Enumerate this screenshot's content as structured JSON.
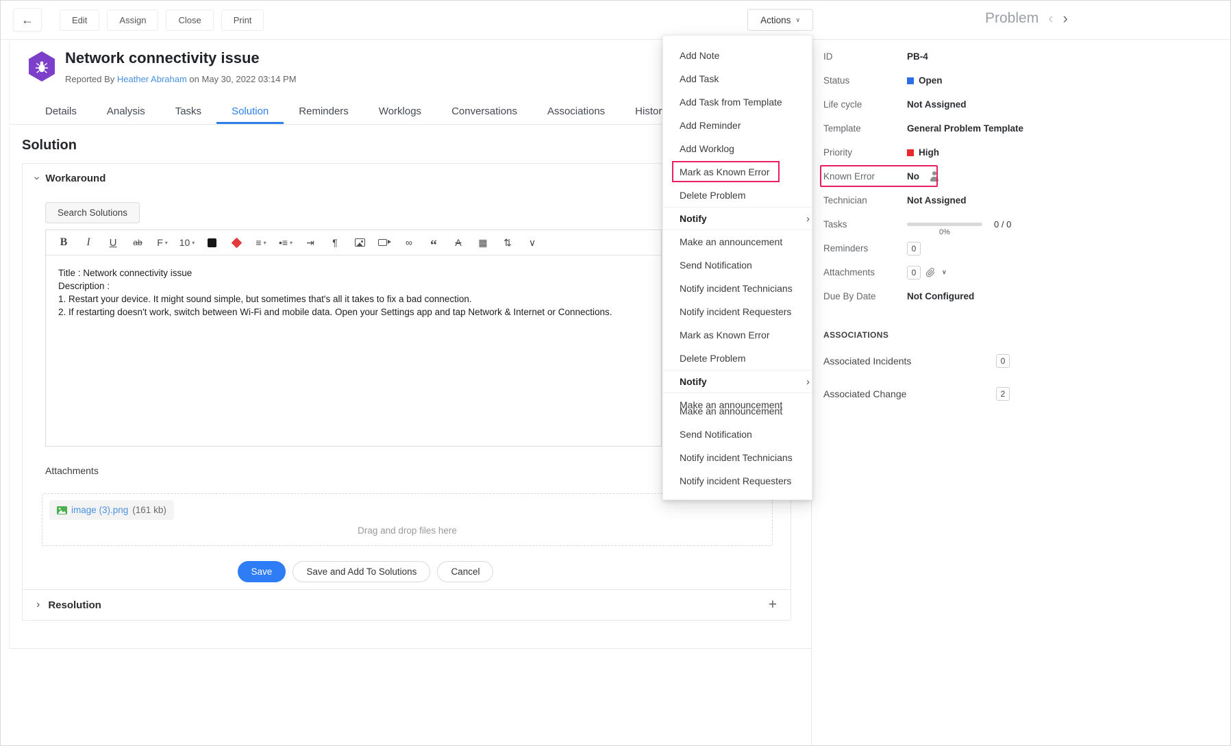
{
  "glyphs": {
    "back": "←",
    "chevron_down": "∨",
    "nav_prev": "‹",
    "nav_next": "›",
    "submenu": "›",
    "expand": "›",
    "plus": "+",
    "dropdown_small": "▾"
  },
  "topbar": {
    "buttons": {
      "edit": "Edit",
      "assign": "Assign",
      "close": "Close",
      "print": "Print"
    },
    "actions_label": "Actions",
    "context_title": "Problem"
  },
  "ticket": {
    "title": "Network connectivity issue",
    "reported_by_label": "Reported By",
    "reporter": "Heather Abraham",
    "reported_on": "on May 30, 2022 03:14 PM"
  },
  "tabs": [
    {
      "label": "Details"
    },
    {
      "label": "Analysis"
    },
    {
      "label": "Tasks"
    },
    {
      "label": "Solution"
    },
    {
      "label": "Reminders"
    },
    {
      "label": "Worklogs"
    },
    {
      "label": "Conversations"
    },
    {
      "label": "Associations"
    },
    {
      "label": "History"
    }
  ],
  "solution": {
    "heading": "Solution",
    "workaround_label": "Workaround",
    "search_button": "Search Solutions",
    "editor": {
      "toolbar": [
        {
          "name": "bold-icon",
          "glyph": "B"
        },
        {
          "name": "italic-icon",
          "glyph": "I"
        },
        {
          "name": "underline-icon",
          "glyph": "U"
        },
        {
          "name": "strikethrough-icon",
          "glyph": "ab"
        },
        {
          "name": "font-family-icon",
          "glyph": "F"
        },
        {
          "name": "font-size-select",
          "glyph": "10"
        },
        {
          "name": "text-color-icon",
          "glyph": ""
        },
        {
          "name": "highlight-color-icon",
          "glyph": ""
        },
        {
          "name": "align-icon",
          "glyph": "≡"
        },
        {
          "name": "list-icon",
          "glyph": "•≡"
        },
        {
          "name": "indent-icon",
          "glyph": "⇥"
        },
        {
          "name": "paragraph-icon",
          "glyph": "¶"
        },
        {
          "name": "insert-image-icon",
          "glyph": ""
        },
        {
          "name": "insert-video-icon",
          "glyph": ""
        },
        {
          "name": "insert-link-icon",
          "glyph": "∞"
        },
        {
          "name": "blockquote-icon",
          "glyph": "“"
        },
        {
          "name": "clear-format-icon",
          "glyph": "A"
        },
        {
          "name": "insert-table-icon",
          "glyph": "▦"
        },
        {
          "name": "line-spacing-icon",
          "glyph": "⇅"
        },
        {
          "name": "more-tools-icon",
          "glyph": "∨"
        }
      ],
      "lines": [
        "Title : Network connectivity issue",
        "Description :",
        "1. Restart your device. It might sound simple, but sometimes that's all it takes to fix a bad connection.",
        "2. If restarting doesn't work, switch between Wi-Fi and mobile data. Open your Settings app and tap Network & Internet or Connections."
      ]
    },
    "attachments_label": "Attachments",
    "attachment": {
      "name": "image (3).png",
      "size": "(161 kb)"
    },
    "drop_text": "Drag and drop files here",
    "buttons": {
      "save": "Save",
      "save_add": "Save and Add To Solutions",
      "cancel": "Cancel"
    },
    "resolution_label": "Resolution"
  },
  "actions_menu": {
    "highlight_color": "#e91e63",
    "items": [
      {
        "label": "Add Note"
      },
      {
        "label": "Add Task"
      },
      {
        "label": "Add Task from Template"
      },
      {
        "label": "Add Reminder"
      },
      {
        "label": "Add Worklog"
      },
      {
        "label": "Mark as Known Error",
        "highlighted": true
      },
      {
        "label": "Delete Problem"
      },
      {
        "label": "Notify",
        "header": true
      },
      {
        "label": "Make an announcement"
      },
      {
        "label": "Send Notification"
      },
      {
        "label": "Notify incident Technicians"
      },
      {
        "label": "Notify incident Requesters"
      },
      {
        "label": "Mark as Known Error"
      },
      {
        "label": "Delete Problem"
      },
      {
        "label": "Notify",
        "header": true
      },
      {
        "label": "Make an announcement",
        "overlap": true
      },
      {
        "label": "Make an announcement"
      },
      {
        "label": "Send Notification"
      },
      {
        "label": "Notify incident Technicians"
      },
      {
        "label": "Notify incident Requesters"
      }
    ]
  },
  "panel": {
    "highlight_color": "#e91e63",
    "status_color": "#2a6fe8",
    "priority_color": "#e8282d",
    "rows": [
      {
        "label": "ID",
        "value": "PB-4"
      },
      {
        "label": "Status",
        "value": "Open"
      },
      {
        "label": "Life cycle",
        "value": "Not Assigned"
      },
      {
        "label": "Template",
        "value": "General Problem Template"
      },
      {
        "label": "Priority",
        "value": "High"
      },
      {
        "label": "Known Error",
        "value": "No",
        "highlighted": true
      },
      {
        "label": "Technician",
        "value": "Not Assigned"
      }
    ],
    "tasks": {
      "label": "Tasks",
      "ratio": "0 / 0",
      "percent": "0%"
    },
    "reminders": {
      "label": "Reminders",
      "count": "0"
    },
    "attachments": {
      "label": "Attachments",
      "count": "0"
    },
    "due_by": {
      "label": "Due By Date",
      "value": "Not Configured"
    },
    "associations": {
      "header": "ASSOCIATIONS",
      "rows": [
        {
          "label": "Associated Incidents",
          "count": "0"
        },
        {
          "label": "Associated Change",
          "count": "2"
        }
      ]
    }
  }
}
